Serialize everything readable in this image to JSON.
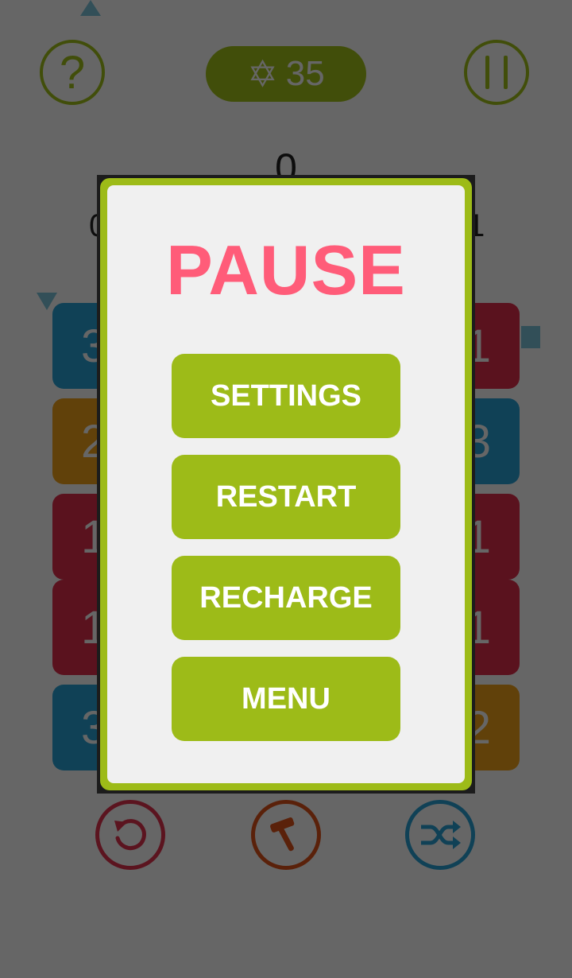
{
  "hud": {
    "help_symbol": "?",
    "stars": "35",
    "score": "0",
    "left_label": "0",
    "right_label": "1"
  },
  "tiles": [
    {
      "value": "3",
      "color": "#2aa3d8"
    },
    {
      "value": "1",
      "color": "#e22d4d"
    },
    {
      "value": "2",
      "color": "#f3a31a"
    },
    {
      "value": "3",
      "color": "#2aa3d8"
    },
    {
      "value": "1",
      "color": "#e22d4d"
    },
    {
      "value": "1",
      "color": "#e22d4d"
    },
    {
      "value": "1",
      "color": "#e22d4d"
    },
    {
      "value": "1",
      "color": "#e22d4d"
    },
    {
      "value": "3",
      "color": "#2aa3d8"
    },
    {
      "value": "2",
      "color": "#f3a31a"
    }
  ],
  "tools": [
    "undo-icon",
    "hammer-icon",
    "shuffle-icon"
  ],
  "pause_dialog": {
    "title": "PAUSE",
    "buttons": {
      "settings": "SETTINGS",
      "restart": "RESTART",
      "recharge": "RECHARGE",
      "menu": "MENU"
    }
  },
  "colors": {
    "accent_green": "#9dbb18",
    "title_pink": "#ff5c79",
    "dialog_bg": "#f0f0f0"
  }
}
